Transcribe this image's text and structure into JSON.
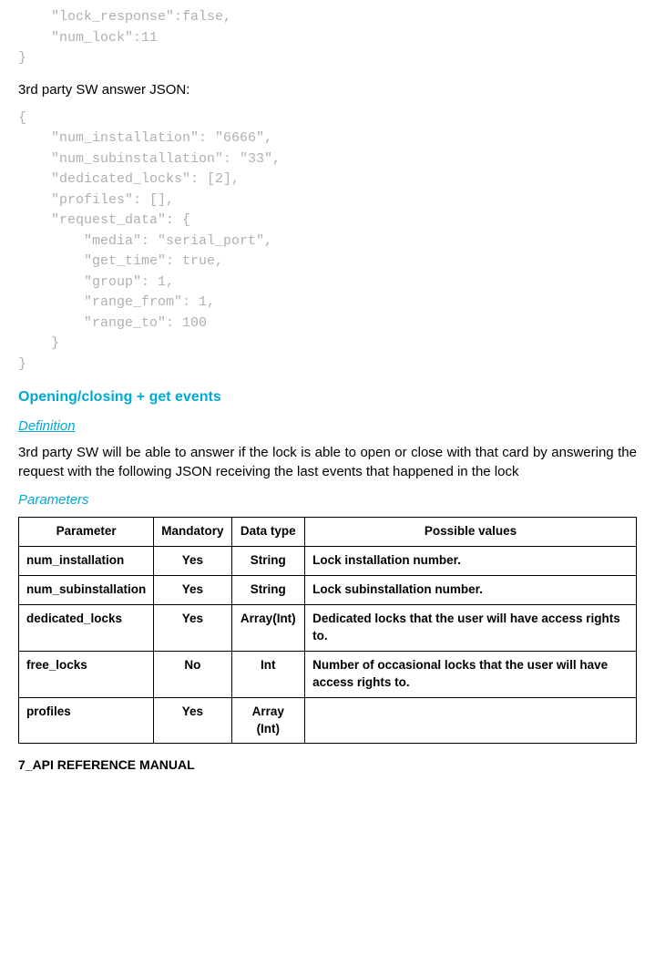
{
  "code_top_lines": [
    "    \"lock_response\":false,",
    "    \"num_lock\":11",
    "}"
  ],
  "answer_label": "3rd party SW answer JSON:",
  "code_answer_lines": [
    "{",
    "    \"num_installation\": \"6666\",",
    "    \"num_subinstallation\": \"33\",",
    "    \"dedicated_locks\": [2],",
    "    \"profiles\": [],",
    "    \"request_data\": {",
    "        \"media\": \"serial_port\",",
    "        \"get_time\": true,",
    "        \"group\": 1,",
    "        \"range_from\": 1,",
    "        \"range_to\": 100",
    "    }",
    "}"
  ],
  "section_heading": "Opening/closing + get events",
  "definition_label": "Definition",
  "definition_text": "3rd party SW will be able to answer if the lock is able to open or close with that card by answering the request with the following JSON receiving the last events that happened in the lock",
  "parameters_label": "Parameters",
  "table": {
    "headers": [
      "Parameter",
      "Mandatory",
      "Data type",
      "Possible values"
    ],
    "rows": [
      {
        "parameter": "num_installation",
        "mandatory": "Yes",
        "datatype": "String",
        "possible": "Lock installation number."
      },
      {
        "parameter": "num_subinstallation",
        "mandatory": "Yes",
        "datatype": "String",
        "possible": "Lock subinstallation number."
      },
      {
        "parameter": "dedicated_locks",
        "mandatory": "Yes",
        "datatype": "Array(Int)",
        "possible": "Dedicated locks that the user will have access rights to."
      },
      {
        "parameter": "free_locks",
        "mandatory": "No",
        "datatype": "Int",
        "possible": "Number of occasional locks that the user will have access rights to."
      },
      {
        "parameter": "profiles",
        "mandatory": "Yes",
        "datatype": "Array (Int)",
        "possible": ""
      }
    ]
  },
  "footer": "7_API REFERENCE MANUAL"
}
